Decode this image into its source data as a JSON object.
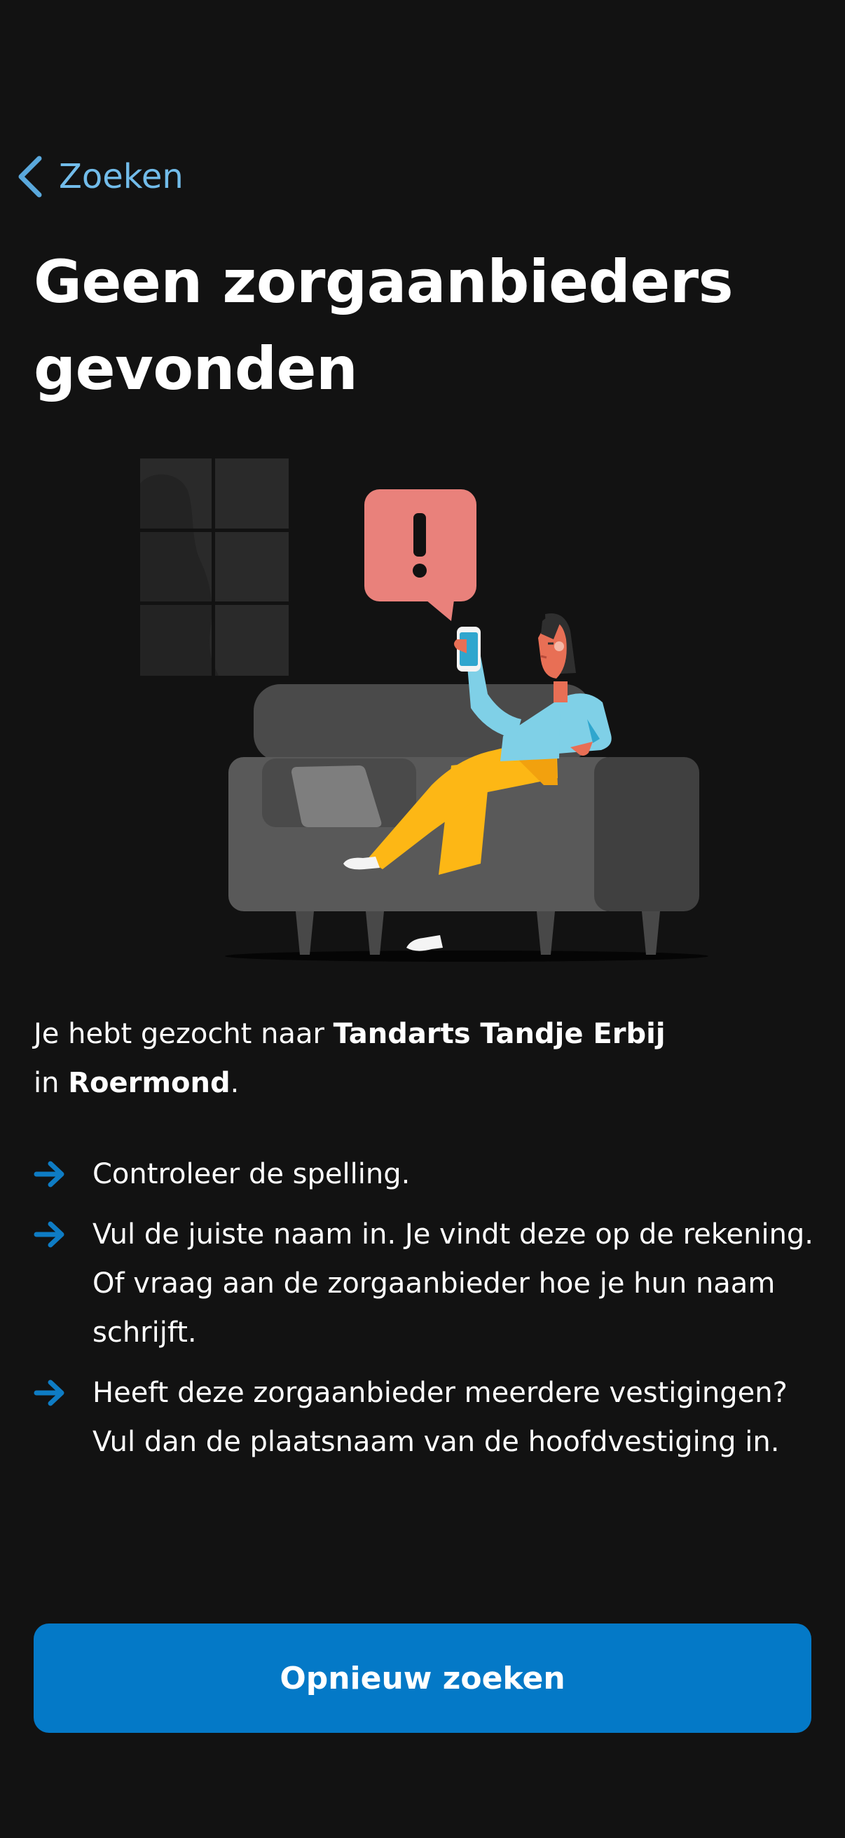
{
  "nav": {
    "back_label": "Zoeken",
    "back_icon": "chevron-left-icon"
  },
  "page": {
    "title": "Geen zorgaanbieders gevonden"
  },
  "search": {
    "prefix": "Je hebt gezocht naar",
    "provider": "Tandarts Tandje Erbij",
    "in_word": "in",
    "location": "Roermond",
    "suffix": "."
  },
  "tips": [
    {
      "icon": "arrow-right-icon",
      "text": "Controleer de spelling."
    },
    {
      "icon": "arrow-right-icon",
      "text": "Vul de juiste naam in. Je vindt deze op de rekening. Of vraag aan de zorgaanbieder hoe je hun naam schrijft."
    },
    {
      "icon": "arrow-right-icon",
      "text": "Heeft deze zorgaanbieder meerdere vestigingen? Vul dan de plaatsnaam van de hoofdvestiging in."
    }
  ],
  "actions": {
    "primary_label": "Opnieuw zoeken"
  },
  "colors": {
    "background": "#121212",
    "accent_link": "#72BCEA",
    "primary_button": "#0479C7",
    "arrow": "#0E7CC4",
    "alert_bubble": "#E9817B",
    "shirt": "#7FD0E7",
    "pants": "#FDB715",
    "sofa": "#4F4F4F"
  }
}
